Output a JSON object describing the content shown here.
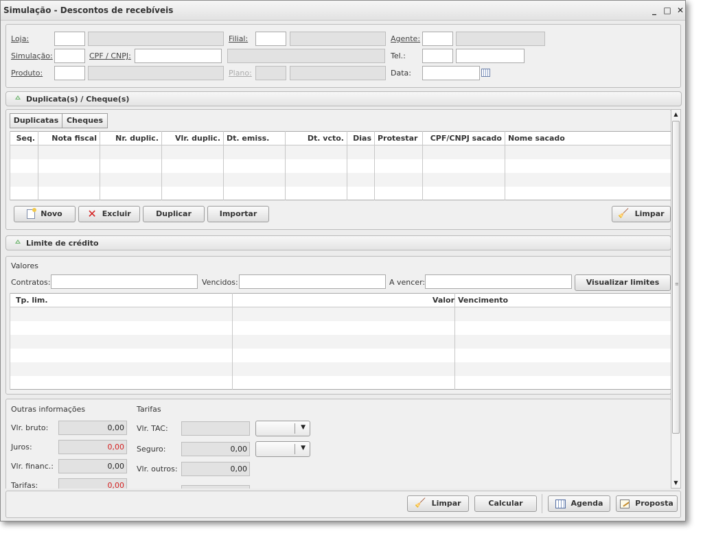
{
  "window": {
    "title": "Simulação - Descontos de recebíveis",
    "minimize": "_",
    "maximize": "□",
    "close": "✕"
  },
  "header": {
    "loja_label": "Loja:",
    "filial_label": "Filial:",
    "agente_label": "Agente:",
    "simulacao_label": "Simulação:",
    "cpf_label": "CPF / CNPJ:",
    "tel_label": "Tel.:",
    "produto_label": "Produto:",
    "plano_label": "Plano:",
    "data_label": "Data:"
  },
  "duplicatas": {
    "section_title": "Duplicata(s) / Cheque(s)",
    "tabs": [
      "Duplicatas",
      "Cheques"
    ],
    "columns": [
      "Seq.",
      "Nota fiscal",
      "Nr. duplic.",
      "Vlr. duplic.",
      "Dt. emiss.",
      "Dt. vcto.",
      "Dias",
      "Protestar",
      "CPF/CNPJ sacado",
      "Nome sacado"
    ],
    "buttons": {
      "novo": "Novo",
      "excluir": "Excluir",
      "duplicar": "Duplicar",
      "importar": "Importar",
      "limpar": "Limpar"
    }
  },
  "limite": {
    "section_title": "Limite de crédito",
    "valores_title": "Valores",
    "contratos_label": "Contratos:",
    "vencidos_label": "Vencidos:",
    "a_vencer_label": "A vencer:",
    "visualizar_button": "Visualizar limites",
    "columns": [
      "Tp. lim.",
      "Valor",
      "Vencimento"
    ]
  },
  "outras": {
    "title": "Outras informações",
    "vlr_bruto_label": "Vlr. bruto:",
    "vlr_bruto": "0,00",
    "juros_label": "Juros:",
    "juros": "0,00",
    "vlr_financ_label": "Vlr. financ.:",
    "vlr_financ": "0,00",
    "tarifas_label": "Tarifas:",
    "tarifas": "0,00"
  },
  "tarifas": {
    "title": "Tarifas",
    "vlr_tac_label": "Vlr. TAC:",
    "seguro_label": "Seguro:",
    "seguro": "0,00",
    "vlr_outros_label": "Vlr. outros:",
    "vlr_outros": "0,00"
  },
  "footer": {
    "limpar": "Limpar",
    "calcular": "Calcular",
    "agenda": "Agenda",
    "proposta": "Proposta"
  },
  "colors": {
    "red_value": "#d42020",
    "readonly_bg": "#e2e2e2"
  }
}
